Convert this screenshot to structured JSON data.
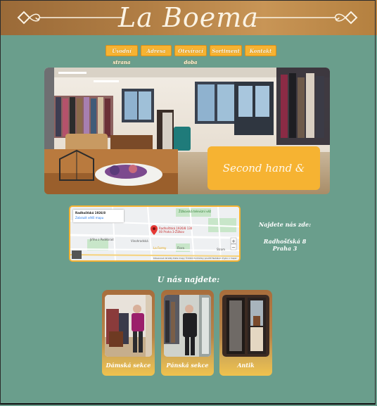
{
  "header": {
    "logo": "La Boema"
  },
  "nav": {
    "items": [
      "Úvodní strana",
      "Adresa",
      "Otevírací doba",
      "Sortiment",
      "Kontakt"
    ]
  },
  "hero": {
    "caption": "Second hand & Antique"
  },
  "map": {
    "address": "Radhošťská 1926/8",
    "link": "Zobrazit větší mapu",
    "pin_label": "Radhošťská 1926/8 130 00 Praha 3-Žižkov",
    "labels": [
      "Žižkovská televizní věž",
      "Jiřího z Poděbrad",
      "Vinohradská",
      "Flora",
      "Strom",
      "La Formy"
    ],
    "footer": "Klávesové zkratky  Data mapy ©2022  Podmínky použití  Nahlásit chybu v mapě"
  },
  "find": {
    "title": "Najdete nás zde:",
    "street": "Radhošťská 8",
    "city": "Praha 3"
  },
  "sections": {
    "title": "U nás najdete:",
    "cards": [
      {
        "label": "Dámská sekce"
      },
      {
        "label": "Pánská sekce"
      },
      {
        "label": "Antik"
      }
    ]
  },
  "colors": {
    "background": "#6a9e8c",
    "header": "#b27f45",
    "accent": "#f6b332"
  }
}
